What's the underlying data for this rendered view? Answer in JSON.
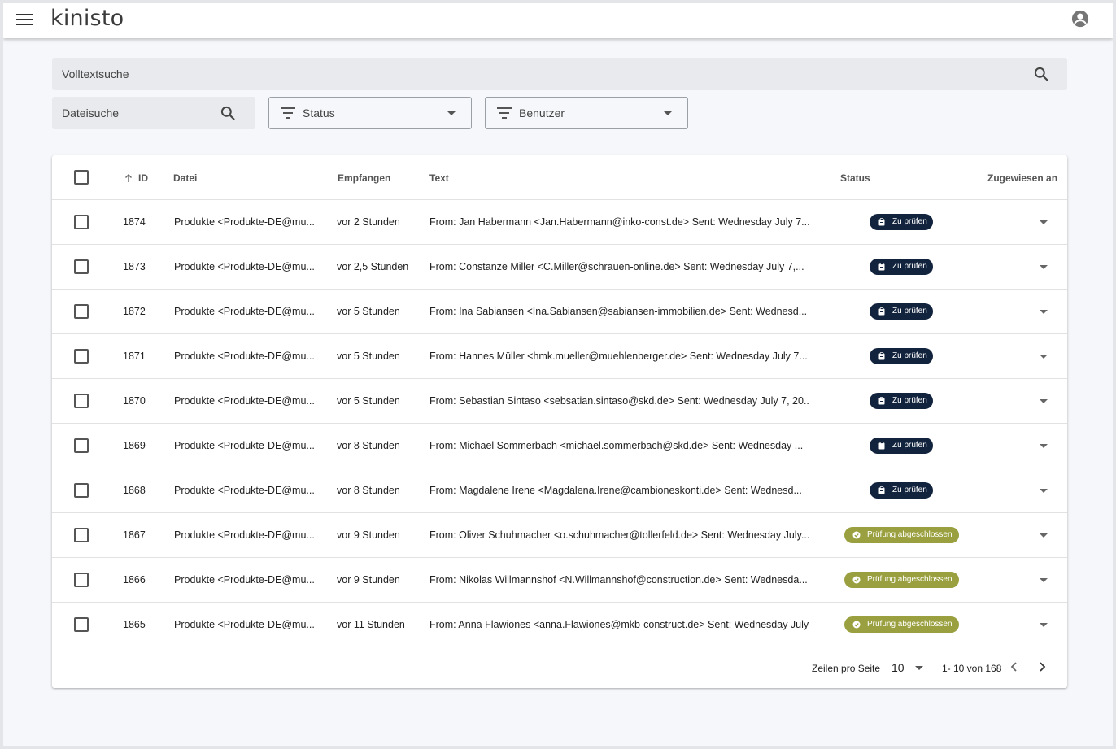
{
  "app": {
    "logo": "kinisto"
  },
  "search": {
    "fulltext_placeholder": "Volltextsuche",
    "file_placeholder": "Dateisuche"
  },
  "filters": {
    "status_label": "Status",
    "user_label": "Benutzer"
  },
  "table": {
    "headers": {
      "id": "ID",
      "file": "Datei",
      "received": "Empfangen",
      "text": "Text",
      "status": "Status",
      "assigned": "Zugewiesen an"
    },
    "rows": [
      {
        "id": "1874",
        "file": "Produkte <Produkte-DE@mu...",
        "received": "vor 2 Stunden",
        "text": "From: Jan Habermann <Jan.Habermann@inko-const.de> Sent: Wednesday July 7...",
        "status": "Zu prüfen",
        "status_kind": "pending"
      },
      {
        "id": "1873",
        "file": "Produkte <Produkte-DE@mu...",
        "received": "vor 2,5 Stunden",
        "text": "From: Constanze Miller <C.Miller@schrauen-online.de> Sent: Wednesday  July 7,...",
        "status": "Zu prüfen",
        "status_kind": "pending"
      },
      {
        "id": "1872",
        "file": "Produkte <Produkte-DE@mu...",
        "received": "vor 5 Stunden",
        "text": "From: Ina Sabiansen <Ina.Sabiansen@sabiansen-immobilien.de> Sent: Wednesd...",
        "status": "Zu prüfen",
        "status_kind": "pending"
      },
      {
        "id": "1871",
        "file": "Produkte <Produkte-DE@mu...",
        "received": "vor 5 Stunden",
        "text": "From: Hannes Müller <hmk.mueller@muehlenberger.de> Sent: Wednesday July 7...",
        "status": "Zu prüfen",
        "status_kind": "pending"
      },
      {
        "id": "1870",
        "file": "Produkte <Produkte-DE@mu...",
        "received": "vor 5 Stunden",
        "text": "From: Sebastian Sintaso <sebsatian.sintaso@skd.de> Sent: Wednesday July 7, 20...",
        "status": "Zu prüfen",
        "status_kind": "pending"
      },
      {
        "id": "1869",
        "file": "Produkte <Produkte-DE@mu...",
        "received": "vor 8 Stunden",
        "text": "From: Michael Sommerbach <michael.sommerbach@skd.de> Sent: Wednesday ...",
        "status": "Zu prüfen",
        "status_kind": "pending"
      },
      {
        "id": "1868",
        "file": "Produkte <Produkte-DE@mu...",
        "received": "vor 8 Stunden",
        "text": "From: Magdalene Irene <Magdalena.Irene@cambioneskonti.de> Sent: Wednesd...",
        "status": "Zu prüfen",
        "status_kind": "pending"
      },
      {
        "id": "1867",
        "file": "Produkte <Produkte-DE@mu...",
        "received": "vor 9 Stunden",
        "text": "From: Oliver Schuhmacher <o.schuhmacher@tollerfeld.de> Sent: Wednesday July...",
        "status": "Prüfung abgeschlossen",
        "status_kind": "done"
      },
      {
        "id": "1866",
        "file": "Produkte <Produkte-DE@mu...",
        "received": "vor 9 Stunden",
        "text": "From: Nikolas Willmannshof <N.Willmannshof@construction.de> Sent: Wednesda...",
        "status": "Prüfung abgeschlossen",
        "status_kind": "done"
      },
      {
        "id": "1865",
        "file": "Produkte <Produkte-DE@mu...",
        "received": "vor 11 Stunden",
        "text": "From: Anna Flawiones <anna.Flawiones@mkb-construct.de> Sent: Wednesday July...",
        "status": "Prüfung abgeschlossen",
        "status_kind": "done"
      }
    ]
  },
  "pagination": {
    "rows_per_page_label": "Zeilen pro Seite",
    "rows_per_page": "10",
    "range": "1- 10 von 168"
  },
  "colors": {
    "pending_badge": "#12233d",
    "done_badge": "#9aa03f",
    "background": "#f5f7fa"
  },
  "icons": {
    "menu": "menu-icon",
    "account": "account-circle-icon",
    "search": "search-icon",
    "filter": "filter-icon",
    "sort": "arrow-up-icon",
    "pending": "clipboard-icon",
    "done": "check-circle-icon"
  }
}
